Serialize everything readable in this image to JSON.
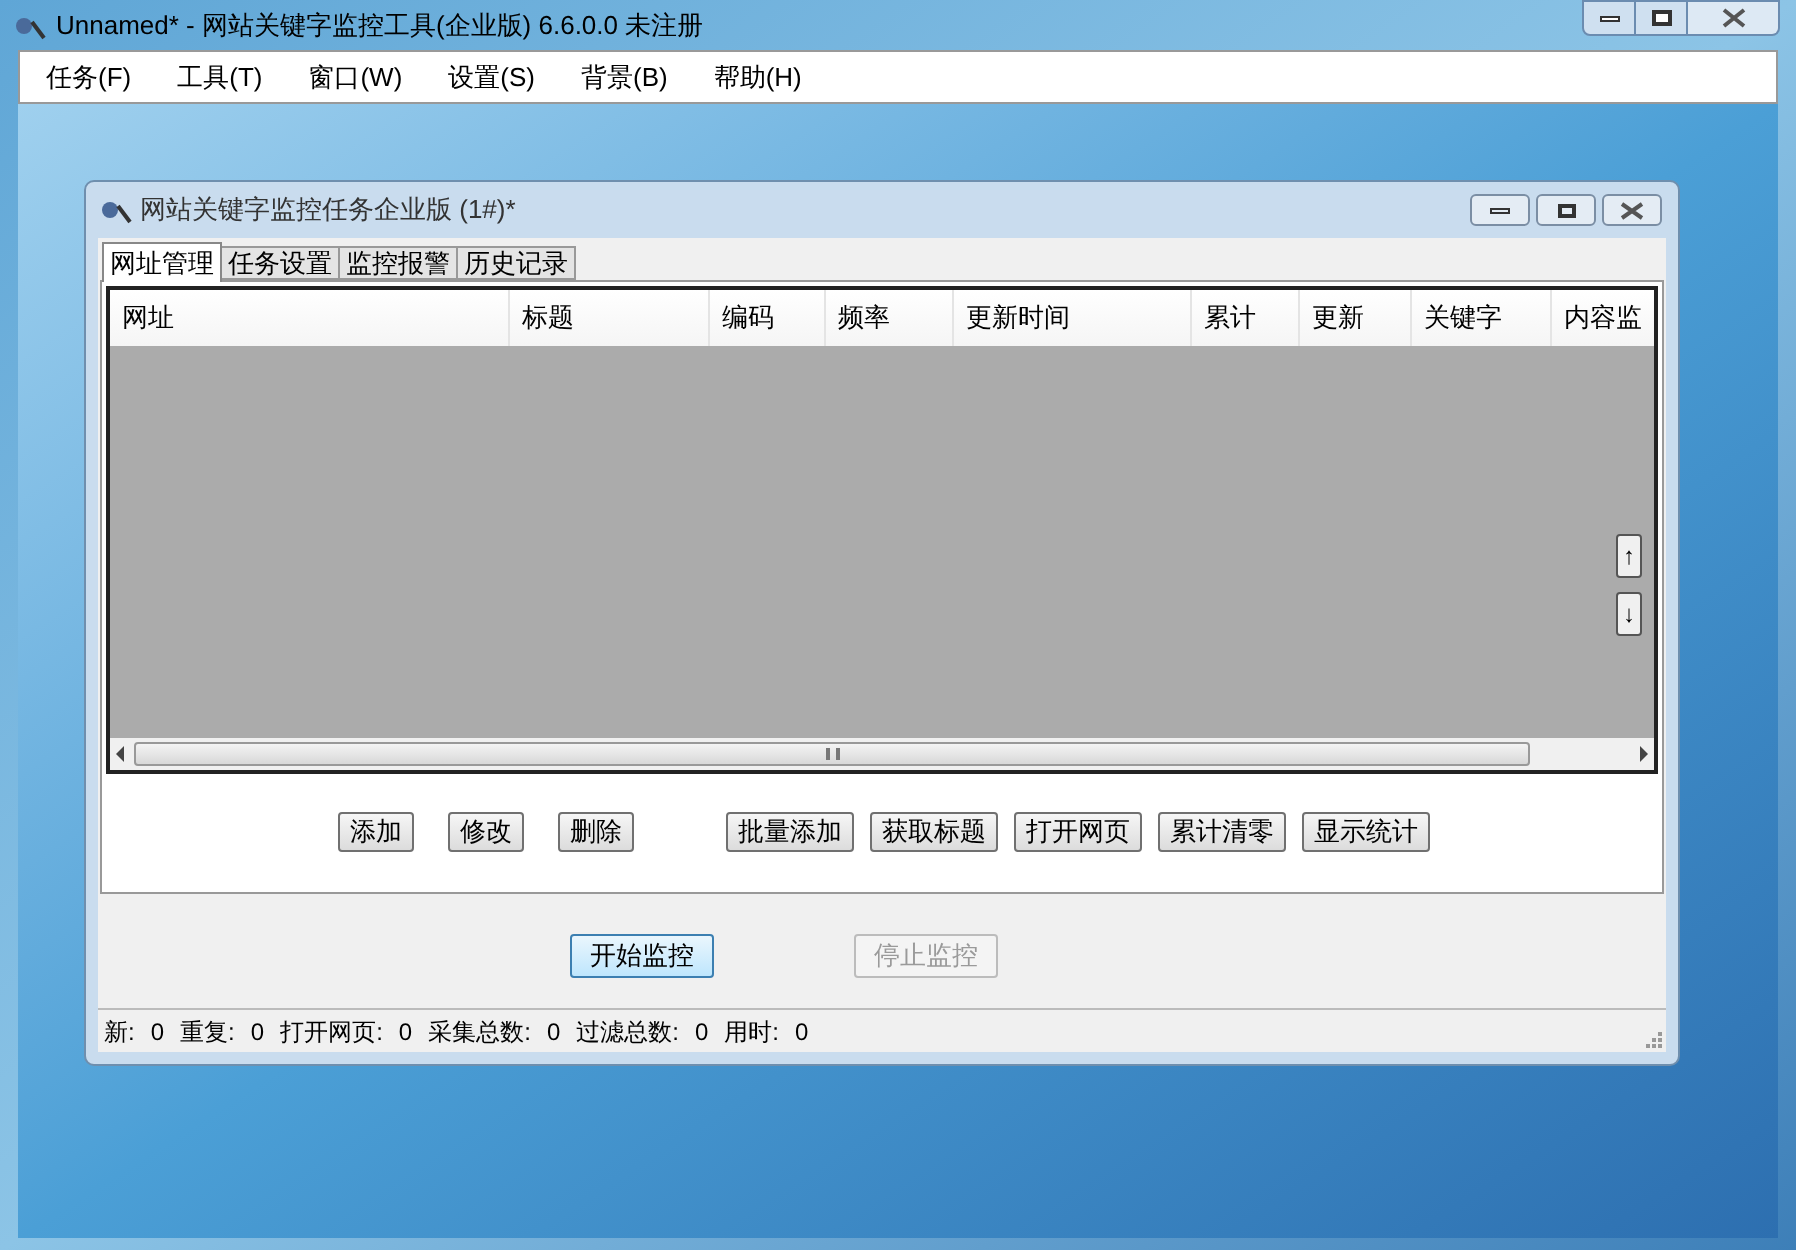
{
  "app_window": {
    "title": "Unnamed* - 网站关键字监控工具(企业版) 6.6.0.0  未注册"
  },
  "menu": [
    "任务(F)",
    "工具(T)",
    "窗口(W)",
    "设置(S)",
    "背景(B)",
    "帮助(H)"
  ],
  "child_window": {
    "title": "网站关键字监控任务企业版  (1#)*"
  },
  "tabs": [
    {
      "label": "网址管理",
      "selected": true
    },
    {
      "label": "任务设置",
      "selected": false
    },
    {
      "label": "监控报警",
      "selected": false
    },
    {
      "label": "历史记录",
      "selected": false
    }
  ],
  "table": {
    "columns": [
      "网址",
      "标题",
      "编码",
      "频率",
      "更新时间",
      "累计",
      "更新",
      "关键字",
      "内容监"
    ]
  },
  "side_buttons": [
    "↑",
    "↓"
  ],
  "list_buttons": {
    "edit_group": [
      "添加",
      "修改",
      "删除"
    ],
    "tool_group": [
      "批量添加",
      "获取标题",
      "打开网页",
      "累计清零",
      "显示统计"
    ]
  },
  "monitor_buttons": [
    {
      "label": "开始监控",
      "disabled": false
    },
    {
      "label": "停止监控",
      "disabled": true
    }
  ],
  "status_bar": [
    {
      "label": "新:",
      "value": "0"
    },
    {
      "label": "重复:",
      "value": "0"
    },
    {
      "label": "打开网页:",
      "value": "0"
    },
    {
      "label": "采集总数:",
      "value": "0"
    },
    {
      "label": "过滤总数:",
      "value": "0"
    },
    {
      "label": "用时:",
      "value": "0"
    }
  ]
}
